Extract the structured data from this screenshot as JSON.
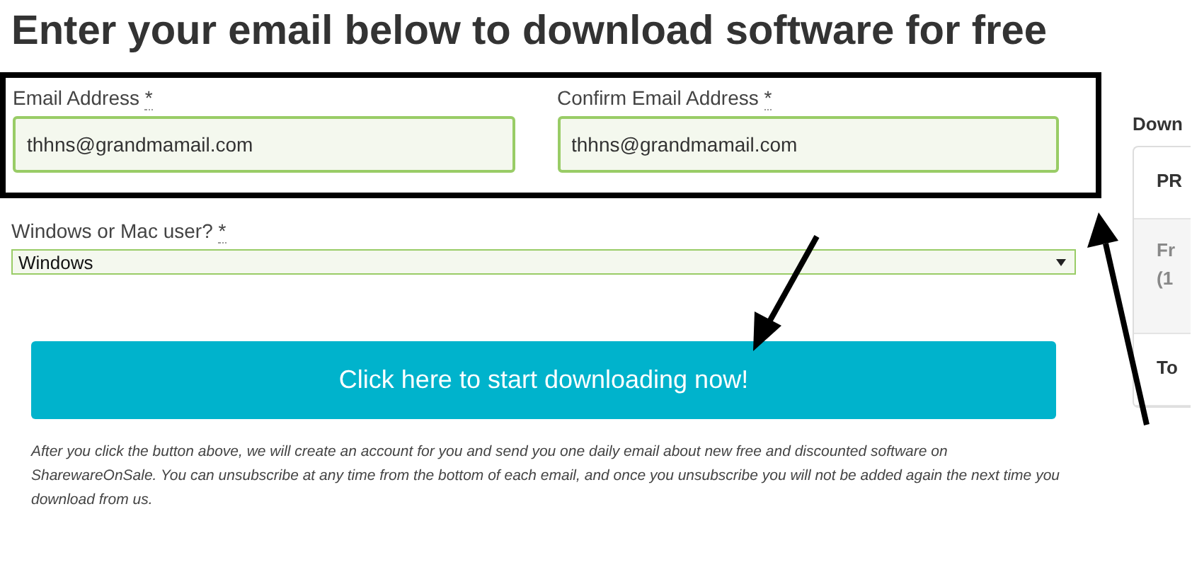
{
  "heading": "Enter your email below to download software for free",
  "email_fields": [
    {
      "label": "Email Address",
      "required_mark": "*",
      "value": "thhns@grandmamail.com"
    },
    {
      "label": "Confirm Email Address",
      "required_mark": "*",
      "value": "thhns@grandmamail.com"
    }
  ],
  "platform_select": {
    "label": "Windows or Mac user?",
    "required_mark": "*",
    "value": "Windows"
  },
  "download_button": "Click here to start downloading now!",
  "disclaimer": "After you click the button above, we will create an account for you and send you one daily email about new free and discounted software on SharewareOnSale. You can unsubscribe at any time from the bottom of each email, and once you unsubscribe you will not be added again the next time you download from us.",
  "side_panel": {
    "title": "Down",
    "rows": [
      {
        "lines": [
          "PR"
        ],
        "shaded": false
      },
      {
        "lines": [
          "Fr",
          "(1"
        ],
        "shaded": true
      },
      {
        "lines": [
          "To"
        ],
        "shaded": false
      }
    ]
  }
}
